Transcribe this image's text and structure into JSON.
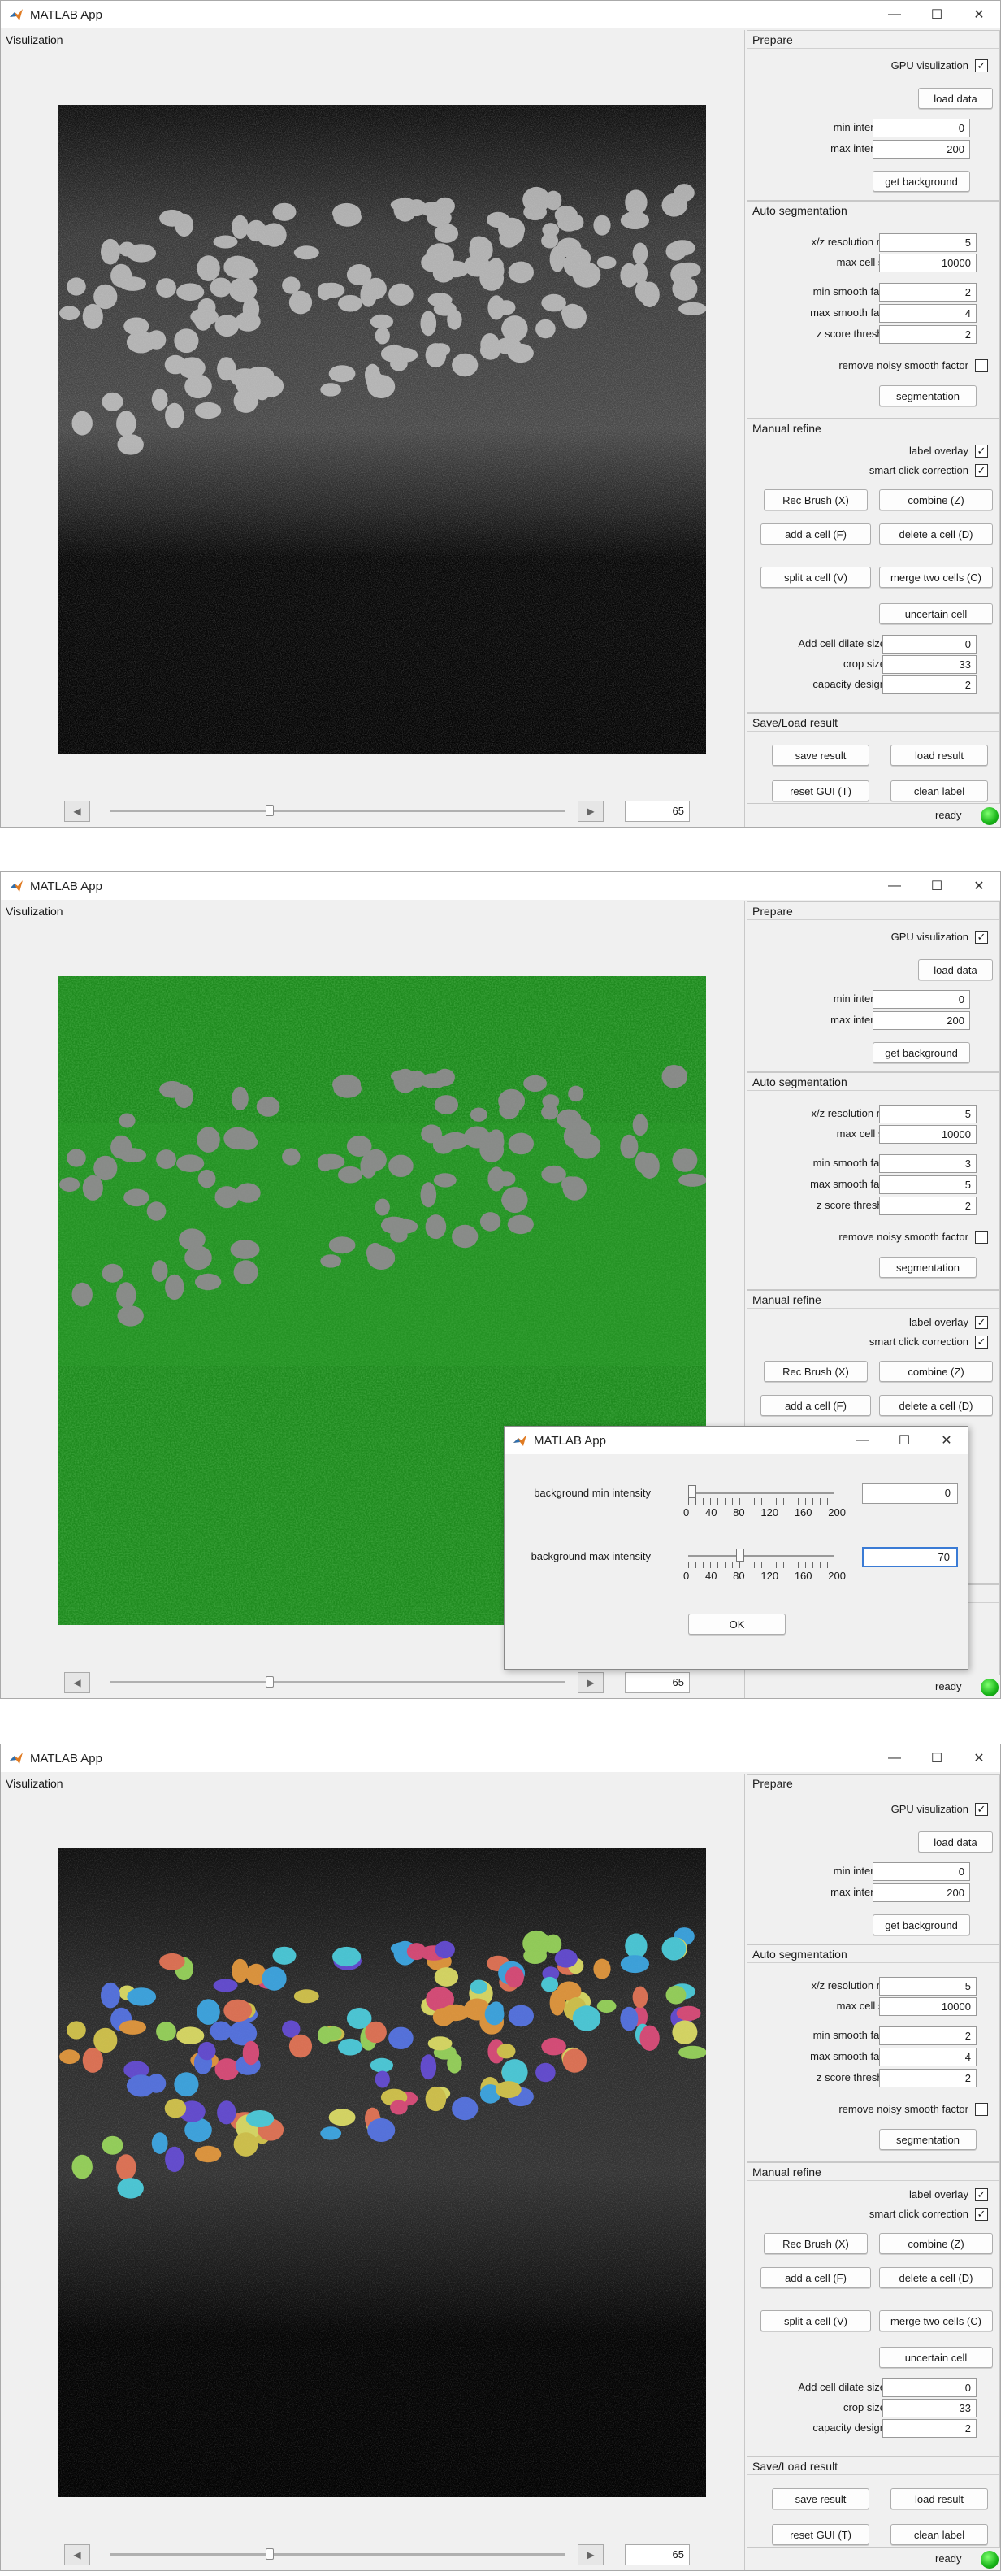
{
  "window_title": "MATLAB App",
  "panels": {
    "visualization": "Visulization",
    "prepare": "Prepare",
    "auto_seg": "Auto segmentation",
    "manual_refine": "Manual refine",
    "save_load": "Save/Load result"
  },
  "labels": {
    "gpu": "GPU visulization",
    "load_data": "load data",
    "min_intensity": "min intensity",
    "max_intensity": "max intensity",
    "get_background": "get background",
    "xz_ratio": "x/z resolution ratio",
    "max_cell": "max cell size",
    "min_smooth": "min smooth factor",
    "max_smooth": "max smooth factor",
    "z_score": "z score threshold",
    "remove_noisy": "remove noisy smooth factor",
    "segmentation": "segmentation",
    "label_overlay": "label overlay",
    "smart_click": "smart click correction",
    "rec_brush": "Rec Brush (X)",
    "combine": "combine (Z)",
    "add_cell": "add a cell (F)",
    "delete_cell": "delete a cell (D)",
    "split_cell": "split a cell (V)",
    "merge_cells": "merge two cells (C)",
    "uncertain": "uncertain cell",
    "add_dilate": "Add cell dilate size",
    "crop_size": "crop size",
    "capacity": "capacity design",
    "save_result": "save result",
    "load_result": "load result",
    "reset_gui": "reset GUI (T)",
    "clean_label": "clean label",
    "ready": "ready"
  },
  "windows": [
    {
      "slice": "65",
      "min_intensity": "0",
      "max_intensity": "200",
      "xz_ratio": "5",
      "max_cell": "10000",
      "min_smooth": "2",
      "max_smooth": "4",
      "z_score": "2",
      "add_dilate": "0",
      "crop_size": "33",
      "capacity": "2"
    },
    {
      "slice": "65",
      "min_intensity": "0",
      "max_intensity": "200",
      "xz_ratio": "5",
      "max_cell": "10000",
      "min_smooth": "3",
      "max_smooth": "5",
      "z_score": "2"
    },
    {
      "slice": "65",
      "min_intensity": "0",
      "max_intensity": "200",
      "xz_ratio": "5",
      "max_cell": "10000",
      "min_smooth": "2",
      "max_smooth": "4",
      "z_score": "2",
      "add_dilate": "0",
      "crop_size": "33",
      "capacity": "2"
    }
  ],
  "dialog": {
    "title": "MATLAB App",
    "bg_min_label": "background min intensity",
    "bg_min_value": "0",
    "bg_max_label": "background max intensity",
    "bg_max_value": "70",
    "tick_labels": [
      "0",
      "40",
      "80",
      "120",
      "160",
      "200"
    ],
    "ok": "OK"
  },
  "colors": {
    "green_overlay": "#1f8a1f",
    "ready_lamp": "#18b418"
  }
}
